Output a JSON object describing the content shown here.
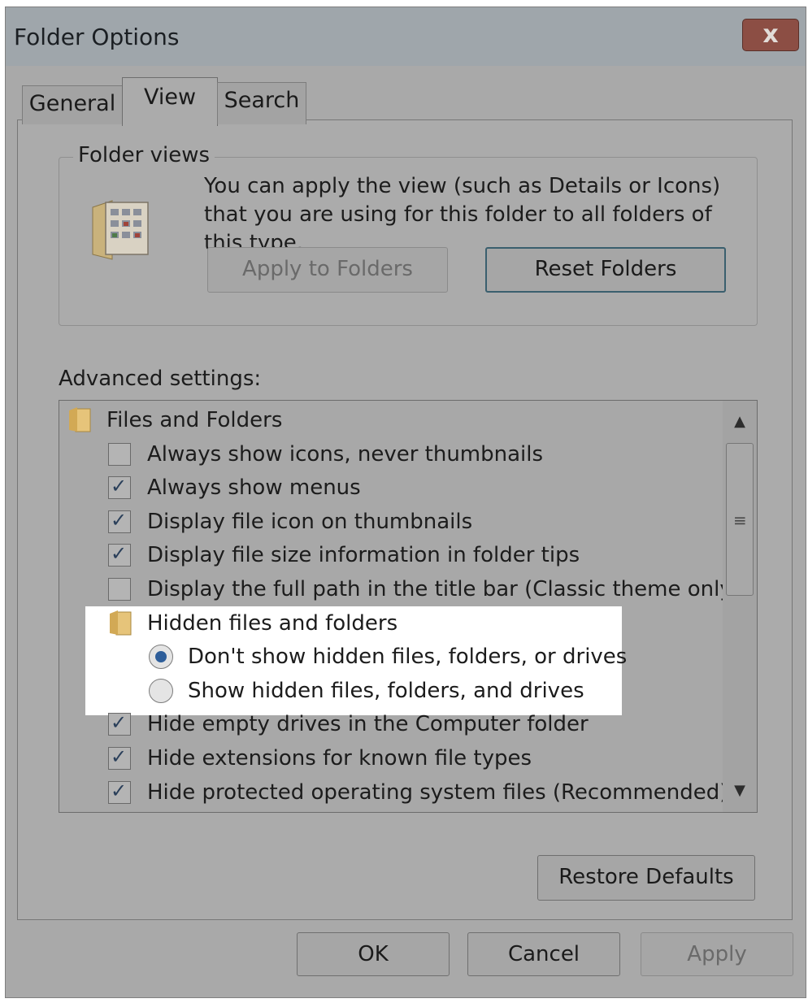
{
  "window": {
    "title": "Folder Options",
    "close_label": "x"
  },
  "tabs": [
    {
      "label": "General"
    },
    {
      "label": "View",
      "selected": true
    },
    {
      "label": "Search"
    }
  ],
  "folder_views": {
    "group_label": "Folder views",
    "description": "You can apply the view (such as Details or Icons) that you are using for this folder to all folders of this type.",
    "apply_button": "Apply to Folders",
    "apply_button_enabled": false,
    "reset_button": "Reset Folders",
    "icon": "folder-views-icon"
  },
  "advanced": {
    "label": "Advanced settings:",
    "items": [
      {
        "kind": "folder",
        "label": "Files and Folders",
        "indent": 0
      },
      {
        "kind": "checkbox",
        "label": "Always show icons, never thumbnails",
        "checked": false,
        "indent": 1
      },
      {
        "kind": "checkbox",
        "label": "Always show menus",
        "checked": true,
        "indent": 1
      },
      {
        "kind": "checkbox",
        "label": "Display file icon on thumbnails",
        "checked": true,
        "indent": 1
      },
      {
        "kind": "checkbox",
        "label": "Display file size information in folder tips",
        "checked": true,
        "indent": 1
      },
      {
        "kind": "checkbox",
        "label": "Display the full path in the title bar (Classic theme only)",
        "checked": false,
        "indent": 1
      },
      {
        "kind": "folder",
        "label": "Hidden files and folders",
        "indent": 1
      },
      {
        "kind": "radio",
        "label": "Don't show hidden files, folders, or drives",
        "checked": true,
        "indent": 2
      },
      {
        "kind": "radio",
        "label": "Show hidden files, folders, and drives",
        "checked": false,
        "indent": 2
      },
      {
        "kind": "checkbox",
        "label": "Hide empty drives in the Computer folder",
        "checked": true,
        "indent": 1
      },
      {
        "kind": "checkbox",
        "label": "Hide extensions for known file types",
        "checked": true,
        "indent": 1
      },
      {
        "kind": "checkbox",
        "label": "Hide protected operating system files (Recommended)",
        "checked": true,
        "indent": 1
      }
    ],
    "scroll": {
      "up_icon": "▲",
      "down_icon": "▼",
      "grip": "≡"
    }
  },
  "restore_defaults": "Restore Defaults",
  "dialog_buttons": {
    "ok": "OK",
    "cancel": "Cancel",
    "apply": "Apply"
  },
  "colors": {
    "highlight": "#ffffff",
    "radio_selected": "#2e5e9a",
    "check": "#2a3f5a"
  }
}
